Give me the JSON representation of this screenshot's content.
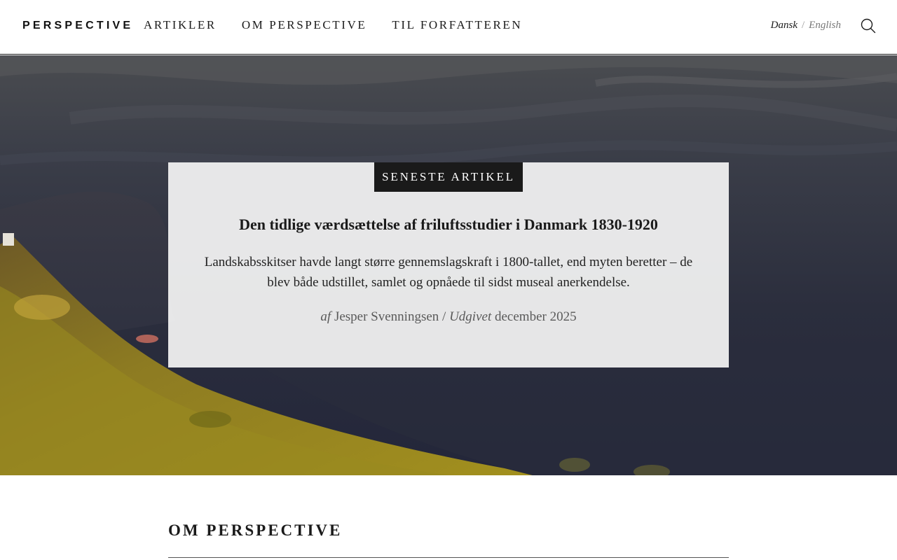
{
  "header": {
    "logo": "PERSPECTIVE",
    "nav": [
      "ARTIKLER",
      "OM PERSPECTIVE",
      "TIL FORFATTEREN"
    ],
    "languages": {
      "active": "Dansk",
      "separator": "/",
      "other": "English"
    },
    "search_icon": "search-icon"
  },
  "feature": {
    "tag": "SENESTE ARTIKEL",
    "title": "Den tidlige værdsættelse af friluftsstudier i Danmark 1830-1920",
    "lede": "Landskabsskitser havde langt større gennemslagskraft i 1800-tallet, end myten beretter – de blev både udstillet, samlet og opnåede til sidst museal anerkendelse.",
    "byline": {
      "by_label": "af",
      "author": "Jesper Svenningsen",
      "separator": "/",
      "published_label": "Udgivet",
      "date": "december 2025"
    }
  },
  "about": {
    "heading": "OM PERSPECTIVE"
  },
  "colors": {
    "ink": "#1a1a1a",
    "muted": "#5a5a5a",
    "sky": "#2c2f3c",
    "hillside": "#8a7a1e"
  }
}
